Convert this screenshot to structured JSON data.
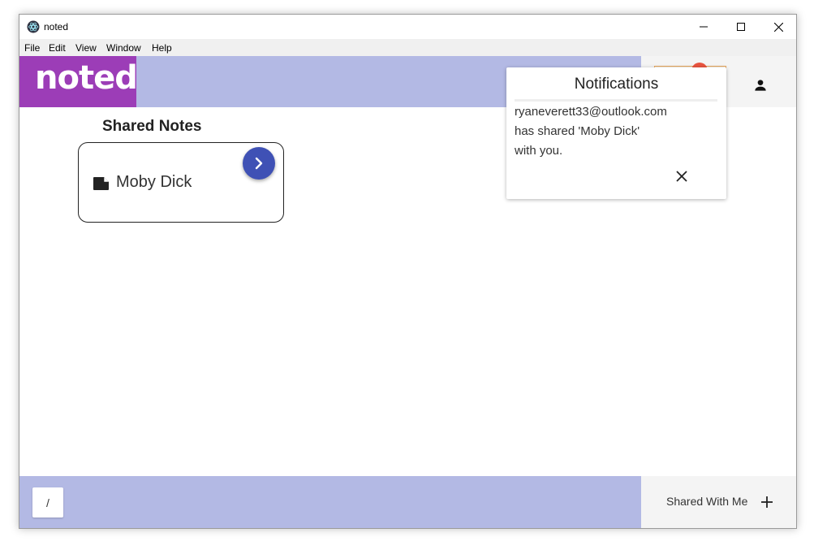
{
  "window": {
    "title": "noted"
  },
  "menu": {
    "items": [
      "File",
      "Edit",
      "View",
      "Window",
      "Help"
    ]
  },
  "header": {
    "logo": "noted"
  },
  "main": {
    "section_title": "Shared Notes",
    "notes": [
      {
        "title": "Moby Dick",
        "icon": "note-icon"
      }
    ]
  },
  "notification": {
    "title": "Notifications",
    "lines": [
      "ryaneverett33@outlook.com",
      "has shared 'Moby Dick'",
      "with you."
    ]
  },
  "footer": {
    "path": "/",
    "view_label": "Shared With Me"
  },
  "colors": {
    "header_bg": "#b3b9e4",
    "logo_bg": "#9c3db7",
    "fab": "#3f51b5"
  }
}
